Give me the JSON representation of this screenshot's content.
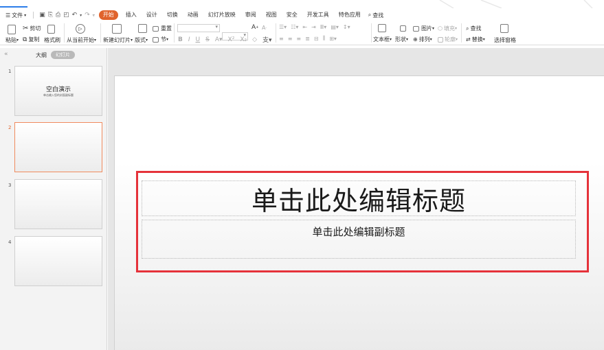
{
  "menubar": {
    "menu_label": "文件",
    "tabs": [
      "开始",
      "插入",
      "设计",
      "切换",
      "动画",
      "幻灯片放映",
      "审阅",
      "视图",
      "安全",
      "开发工具",
      "特色应用"
    ],
    "search_label": "查找"
  },
  "ribbon": {
    "paste": "粘贴",
    "cut": "剪切",
    "copy": "复制",
    "format_painter": "格式刷",
    "from_current": "从当前开始",
    "new_slide": "新建幻灯片",
    "layout": "版式",
    "reset": "重置",
    "section": "节",
    "textbox": "文本框",
    "shape": "形状",
    "picture": "图片",
    "fill": "填充",
    "arrange": "排列",
    "outline": "轮廓",
    "find": "查找",
    "replace": "替换",
    "select_pane": "选择窗格"
  },
  "left_panel": {
    "outline_tab": "大纲",
    "slides_tab": "幻灯片",
    "thumbnails": [
      {
        "num": "1",
        "title": "空白演示",
        "subtitle": "单击输入您的封面副标题"
      },
      {
        "num": "2"
      },
      {
        "num": "3"
      },
      {
        "num": "4"
      }
    ]
  },
  "slide": {
    "title": "单击此处编辑标题",
    "subtitle": "单击此处编辑副标题"
  },
  "colors": {
    "accent": "#e0632c",
    "highlight": "#e5323a"
  }
}
